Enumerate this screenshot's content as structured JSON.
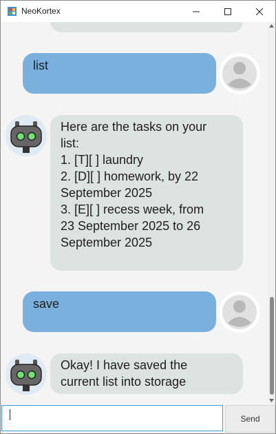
{
  "window": {
    "title": "NeoKortex"
  },
  "messages": [
    {
      "from": "user",
      "lines": [
        "list"
      ]
    },
    {
      "from": "bot",
      "lines": [
        "Here are the tasks on your",
        "list:",
        "1. [T][ ] laundry",
        "2. [D][ ] homework, by 22",
        "September 2025",
        "3. [E][ ] recess week, from",
        "23 September 2025 to 26",
        "September 2025"
      ]
    },
    {
      "from": "user",
      "lines": [
        "save"
      ]
    },
    {
      "from": "bot",
      "lines": [
        "Okay! I have saved the",
        "current list into storage"
      ]
    }
  ],
  "input": {
    "value": ""
  },
  "send_button": {
    "label": "Send"
  },
  "colors": {
    "user_bubble": "#7ab0de",
    "bot_bubble": "#dce3e1",
    "input_focus": "#39a0d8"
  }
}
